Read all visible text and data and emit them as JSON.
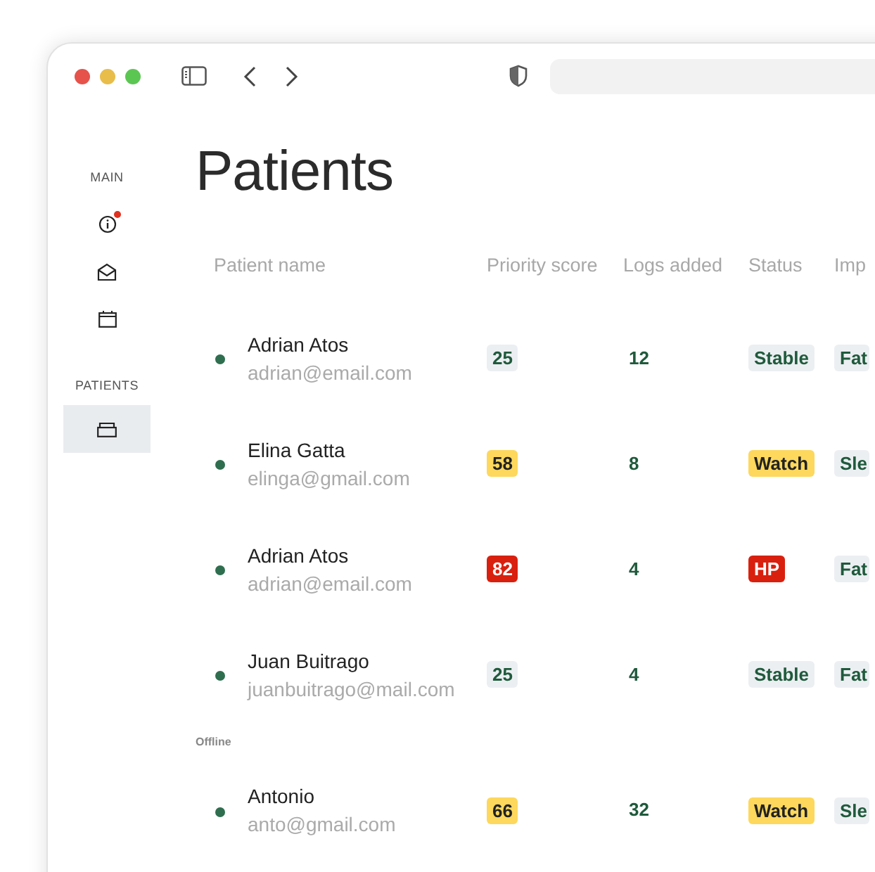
{
  "sidebar": {
    "sections": [
      {
        "label": "MAIN",
        "items": [
          {
            "selected": false,
            "alert": true
          },
          {
            "selected": false,
            "alert": false
          },
          {
            "selected": false,
            "alert": false
          }
        ]
      },
      {
        "label": "PATIENTS",
        "items": [
          {
            "selected": true,
            "alert": false
          }
        ]
      }
    ]
  },
  "title": "Patients",
  "table": {
    "columns": [
      "Patient name",
      "Priority score",
      "Logs added",
      "Status",
      "Imp"
    ],
    "groups": [
      {
        "rows": [
          {
            "name": "Adrian Atos",
            "email": "adrian@email.com",
            "score": {
              "text": "25",
              "color": "#eceff2"
            },
            "logs": "12",
            "status": {
              "text": "Stable",
              "color": "#eceff2"
            },
            "column_5": "Fat"
          },
          {
            "name": "Elina Gatta",
            "email": "elinga@gmail.com",
            "score": {
              "text": "58",
              "color": "#fdd85c"
            },
            "logs": "8",
            "status": {
              "text": "Watch",
              "color": "#fdd85c"
            },
            "column_5": "Sle"
          },
          {
            "name": "Adrian Atos",
            "email": "adrian@email.com",
            "score": {
              "text": "82",
              "color": "#d9200e"
            },
            "logs": "4",
            "status": {
              "text": "HP",
              "color": "#d9200e"
            },
            "column_5": "Fat"
          },
          {
            "name": "Juan Buitrago",
            "email": "juanbuitrago@mail.com",
            "score": {
              "text": "25",
              "color": "#eceff2"
            },
            "logs": "4",
            "status": {
              "text": "Stable",
              "color": "#eceff2"
            },
            "column_5": "Fat"
          }
        ]
      },
      {
        "label": "Offline",
        "rows": [
          {
            "name": "Antonio",
            "email": "anto@gmail.com",
            "score": {
              "text": "66",
              "color": "#fdd85c"
            },
            "logs": "32",
            "status": {
              "text": "Watch",
              "color": "#fdd85c"
            },
            "column_5": "Sle"
          }
        ]
      }
    ]
  }
}
